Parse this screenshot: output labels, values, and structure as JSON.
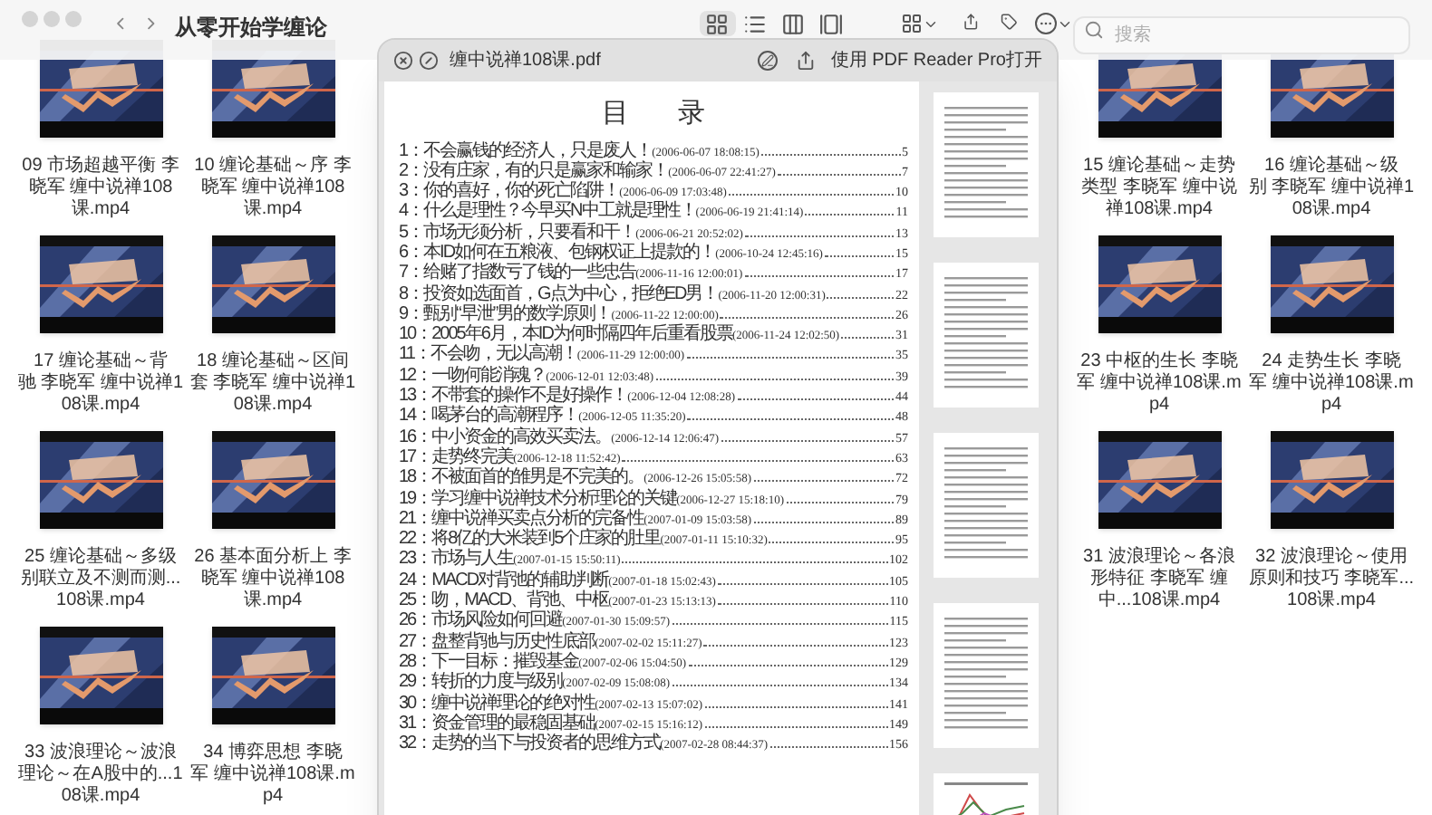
{
  "window": {
    "title": "从零开始学缠论"
  },
  "toolbar": {
    "view_buttons": [
      {
        "selected": true
      },
      {
        "selected": false
      },
      {
        "selected": false
      },
      {
        "selected": false
      }
    ],
    "search": {
      "placeholder": "搜索"
    }
  },
  "files_left": [
    {
      "name": "09 市场超越平衡 李晓军 缠中说禅108课.mp4"
    },
    {
      "name": "10 缠论基础～序 李晓军 缠中说禅108课.mp4"
    },
    {
      "name": "17 缠论基础～背驰 李晓军 缠中说禅108课.mp4"
    },
    {
      "name": "18 缠论基础～区间套 李晓军 缠中说禅108课.mp4"
    },
    {
      "name": "25 缠论基础～多级别联立及不测而测...108课.mp4"
    },
    {
      "name": "26 基本面分析上 李晓军 缠中说禅108课.mp4"
    },
    {
      "name": "33 波浪理论～波浪理论～在A股中的...108课.mp4"
    },
    {
      "name": "34 博弈思想 李晓军 缠中说禅108课.mp4"
    }
  ],
  "files_right": [
    {
      "name": "15 缠论基础～走势类型 李晓军 缠中说禅108课.mp4"
    },
    {
      "name": "16 缠论基础～级别 李晓军 缠中说禅108课.mp4"
    },
    {
      "name": "23 中枢的生长 李晓军 缠中说禅108课.mp4"
    },
    {
      "name": "24 走势生长 李晓军 缠中说禅108课.mp4"
    },
    {
      "name": "31 波浪理论～各浪形特征 李晓军 缠中...108课.mp4"
    },
    {
      "name": "32 波浪理论～使用原则和技巧 李晓军...108课.mp4"
    }
  ],
  "preview": {
    "title": "缠中说禅108课.pdf",
    "open_with": "使用 PDF Reader Pro打开",
    "heading": "目 录",
    "entries": [
      {
        "title": "1：不会赢钱的经济人，只是废人！",
        "date": "(2006-06-07 18:08:15)",
        "page": "5"
      },
      {
        "title": "2：没有庄家，有的只是赢家和输家！",
        "date": "(2006-06-07 22:41:27)",
        "page": "7"
      },
      {
        "title": "3：你的喜好，你的死亡陷阱！",
        "date": "(2006-06-09 17:03:48)",
        "page": "10"
      },
      {
        "title": "4：什么是理性？今早买N中工就是理性！",
        "date": "(2006-06-19 21:41:14)",
        "page": "11"
      },
      {
        "title": "5：市场无须分析，只要看和干！",
        "date": "(2006-06-21 20:52:02)",
        "page": "13"
      },
      {
        "title": "6：本ID如何在五粮液、包钢权证上提款的！",
        "date": "(2006-10-24 12:45:16)",
        "page": "15"
      },
      {
        "title": "7：给赌了指数亏了钱的一些忠告",
        "date": "(2006-11-16 12:00:01)",
        "page": "17"
      },
      {
        "title": "8：投资如选面首，G点为中心，拒绝ED男！",
        "date": "(2006-11-20 12:00:31)",
        "page": "22"
      },
      {
        "title": "9：甄别“早泄”男的数学原则！",
        "date": "(2006-11-22 12:00:00)",
        "page": "26"
      },
      {
        "title": "10：2005年6月，本ID为何时隔四年后重看股票",
        "date": "(2006-11-24 12:02:50)",
        "page": "31"
      },
      {
        "title": "11：不会吻，无以高潮！",
        "date": "(2006-11-29 12:00:00)",
        "page": "35"
      },
      {
        "title": "12：一吻何能消魂？",
        "date": "(2006-12-01 12:03:48)",
        "page": "39"
      },
      {
        "title": "13：不带套的操作不是好操作！",
        "date": "(2006-12-04 12:08:28)",
        "page": "44"
      },
      {
        "title": "14：喝茅台的高潮程序！",
        "date": "(2006-12-05 11:35:20)",
        "page": "48"
      },
      {
        "title": "16：中小资金的高效买卖法。",
        "date": "(2006-12-14 12:06:47)",
        "page": "57"
      },
      {
        "title": "17：走势终完美",
        "date": "(2006-12-18 11:52:42)",
        "page": "63"
      },
      {
        "title": "18：不被面首的雏男是不完美的。",
        "date": "(2006-12-26 15:05:58)",
        "page": "72"
      },
      {
        "title": "19：学习缠中说禅技术分析理论的关键",
        "date": "(2006-12-27 15:18:10)",
        "page": "79"
      },
      {
        "title": "21：缠中说禅买卖点分析的完备性",
        "date": "(2007-01-09 15:03:58)",
        "page": "89"
      },
      {
        "title": "22：将8亿的大米装到5个庄家的肚里",
        "date": "(2007-01-11 15:10:32)",
        "page": "95"
      },
      {
        "title": "23：市场与人生",
        "date": "(2007-01-15 15:50:11)",
        "page": "102"
      },
      {
        "title": "24：MACD对背弛的辅助判断",
        "date": "(2007-01-18 15:02:43)",
        "page": "105"
      },
      {
        "title": "25：吻，MACD、背弛、中枢",
        "date": "(2007-01-23 15:13:13)",
        "page": "110"
      },
      {
        "title": "26：市场风险如何回避",
        "date": "(2007-01-30 15:09:57)",
        "page": "115"
      },
      {
        "title": "27：盘整背驰与历史性底部",
        "date": "(2007-02-02 15:11:27)",
        "page": "123"
      },
      {
        "title": "28：下一目标：摧毁基金",
        "date": "(2007-02-06 15:04:50)",
        "page": "129"
      },
      {
        "title": "29：转折的力度与级别",
        "date": "(2007-02-09 15:08:08)",
        "page": "134"
      },
      {
        "title": "30：缠中说禅理论的绝对性",
        "date": "(2007-02-13 15:07:02)",
        "page": "141"
      },
      {
        "title": "31：资金管理的最稳固基础",
        "date": "(2007-02-15 15:16:12)",
        "page": "149"
      },
      {
        "title": "32：走势的当下与投资者的思维方式",
        "date": "(2007-02-28 08:44:37)",
        "page": "156"
      }
    ]
  }
}
